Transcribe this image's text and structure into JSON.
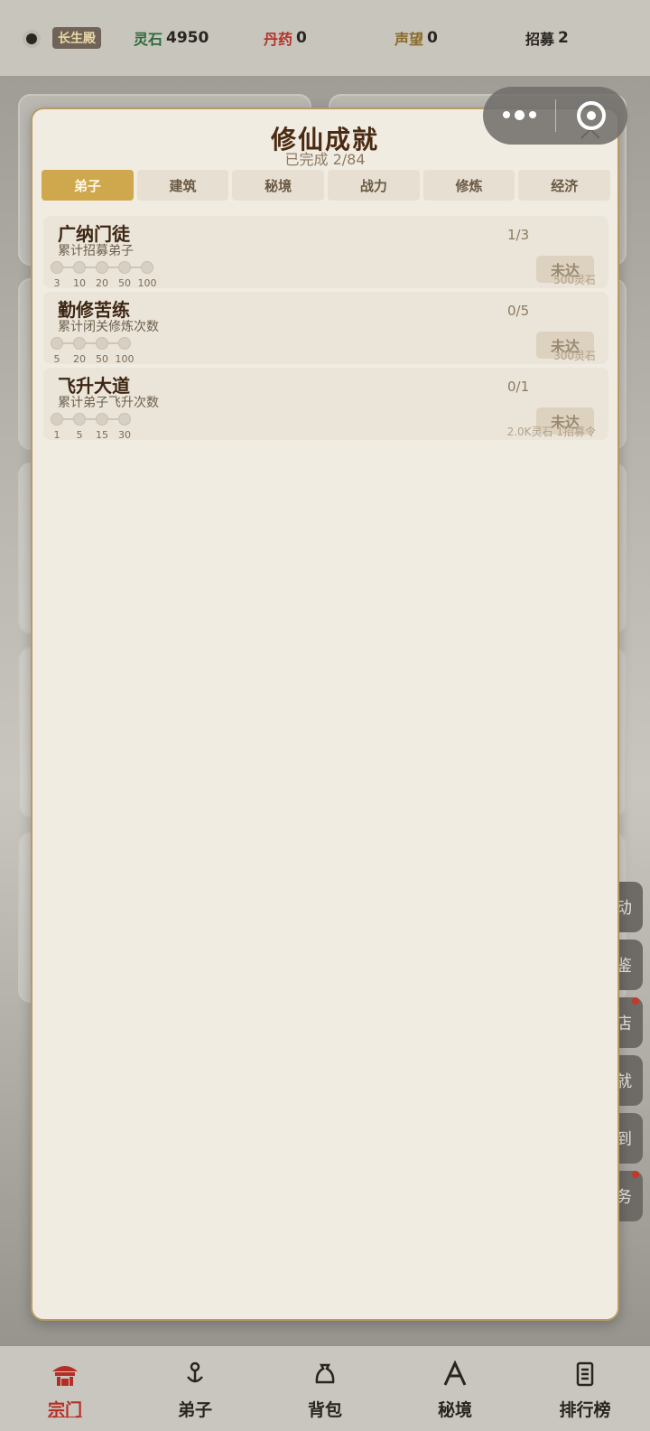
{
  "topbar": {
    "hall": "长生殿",
    "resources": [
      {
        "label": "灵石",
        "value": "4950",
        "color": "#2e6b3a"
      },
      {
        "label": "丹药",
        "value": "0",
        "color": "#b3332a"
      },
      {
        "label": "声望",
        "value": "0",
        "color": "#8a6a2a"
      },
      {
        "label": "招募",
        "value": "2",
        "color": "#2a2420"
      }
    ]
  },
  "modal": {
    "title": "修仙成就",
    "subtitle": "已完成 2/84",
    "tabs": [
      "弟子",
      "建筑",
      "秘境",
      "战力",
      "修炼",
      "经济"
    ],
    "active_tab": "弟子",
    "achievements": [
      {
        "title": "广纳门徒",
        "desc": "累计招募弟子",
        "progress": "1/3",
        "milestones": [
          "3",
          "10",
          "20",
          "50",
          "100"
        ],
        "button": "未达",
        "reward": "500灵石"
      },
      {
        "title": "勤修苦练",
        "desc": "累计闭关修炼次数",
        "progress": "0/5",
        "milestones": [
          "5",
          "20",
          "50",
          "100"
        ],
        "button": "未达",
        "reward": "300灵石"
      },
      {
        "title": "飞升大道",
        "desc": "累计弟子飞升次数",
        "progress": "0/1",
        "milestones": [
          "1",
          "5",
          "15",
          "30"
        ],
        "button": "未达",
        "reward": "2.0K灵石 1招募令"
      }
    ]
  },
  "side_buttons": [
    "动",
    "鉴",
    "店",
    "就",
    "到",
    "务"
  ],
  "bottomnav": {
    "active": "宗门",
    "items": [
      {
        "label": "宗门",
        "icon": "sect-icon"
      },
      {
        "label": "弟子",
        "icon": "disciple-icon"
      },
      {
        "label": "背包",
        "icon": "bag-icon"
      },
      {
        "label": "秘境",
        "icon": "realm-icon"
      },
      {
        "label": "排行榜",
        "icon": "ranking-icon"
      }
    ]
  }
}
